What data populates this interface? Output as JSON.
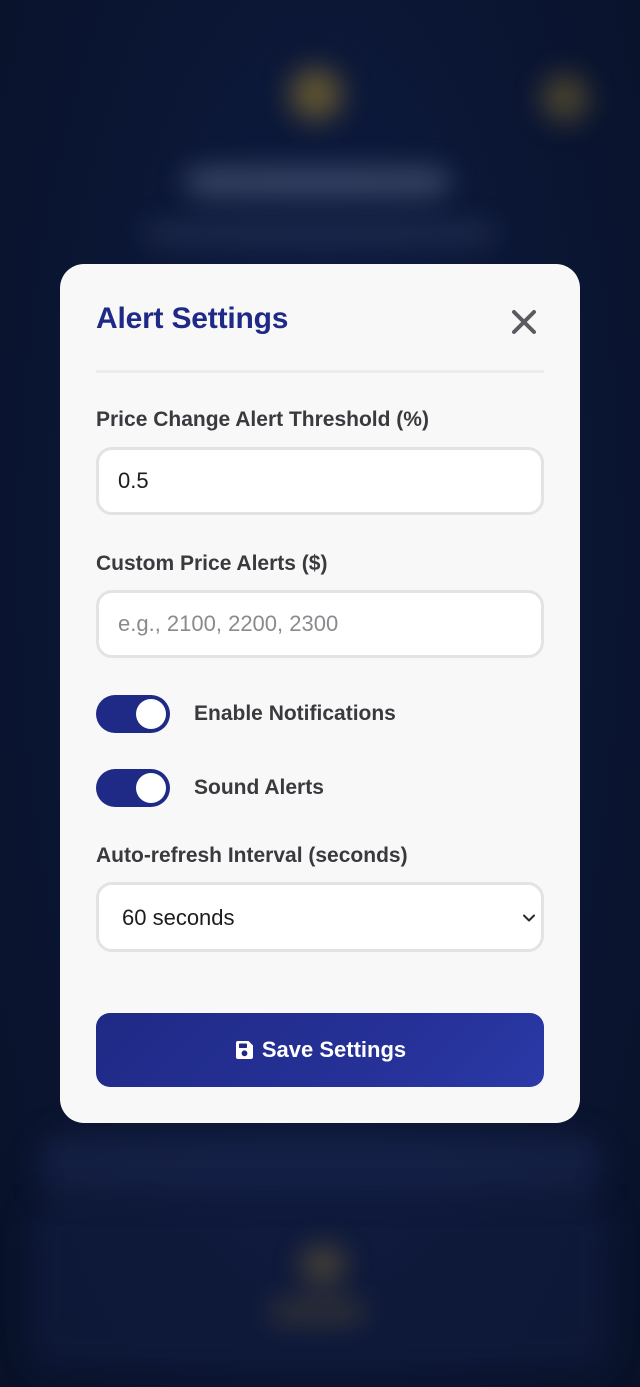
{
  "modal": {
    "title": "Alert Settings",
    "close_icon": "close-icon"
  },
  "threshold": {
    "label": "Price Change Alert Threshold (%)",
    "value": "0.5"
  },
  "custom_alerts": {
    "label": "Custom Price Alerts ($)",
    "value": "",
    "placeholder": "e.g., 2100, 2200, 2300"
  },
  "toggles": [
    {
      "label": "Enable Notifications",
      "enabled": true
    },
    {
      "label": "Sound Alerts",
      "enabled": true
    }
  ],
  "interval": {
    "label": "Auto-refresh Interval (seconds)",
    "selected": "60 seconds",
    "chevron_icon": "chevron-down-icon"
  },
  "save_button": {
    "label": "Save Settings",
    "icon": "floppy-disk-icon"
  },
  "colors": {
    "accent": "#1f2a86",
    "backdrop": "#0b1634",
    "modal_bg": "#f8f8f9"
  }
}
